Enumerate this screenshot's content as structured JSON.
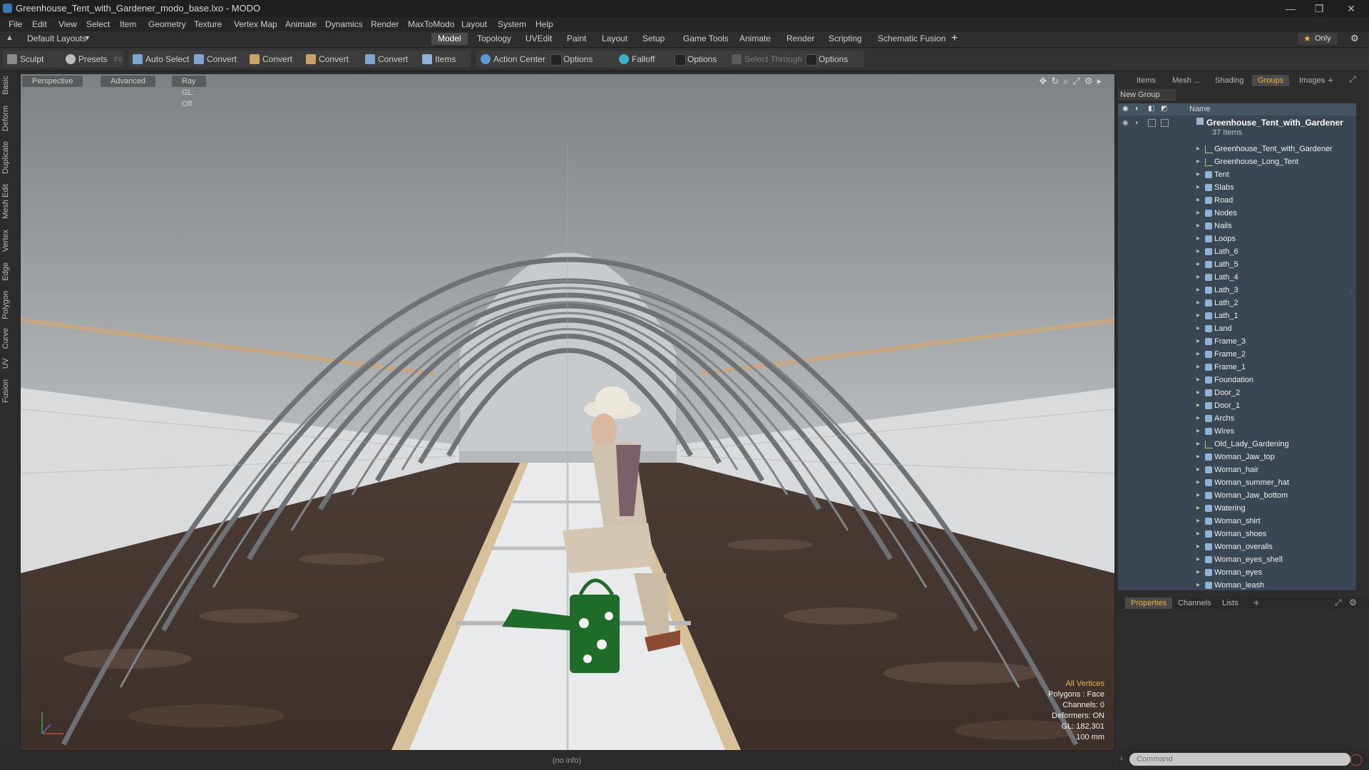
{
  "window": {
    "title": "Greenhouse_Tent_with_Gardener_modo_base.lxo - MODO",
    "controls": [
      "—",
      "❐",
      "✕"
    ]
  },
  "menu": [
    "File",
    "Edit",
    "View",
    "Select",
    "Item",
    "Geometry",
    "Texture",
    "Vertex Map",
    "Animate",
    "Dynamics",
    "Render",
    "MaxToModo",
    "Layout",
    "System",
    "Help"
  ],
  "layout_selector": "Default Layouts",
  "tabs": [
    "Model",
    "Topology",
    "UVEdit",
    "Paint",
    "Layout",
    "Setup",
    "Game Tools",
    "Animate",
    "Render",
    "Scripting",
    "Schematic Fusion"
  ],
  "active_tab": "Model",
  "only_label": "Only",
  "toolbar": {
    "sculpt": "Sculpt",
    "presets": "Presets",
    "presets_key": "F6",
    "auto_select": "Auto Select",
    "convert": "Convert",
    "items": "Items",
    "action_center": "Action Center",
    "options": "Options",
    "falloff": "Falloff",
    "select_through": "Select Through"
  },
  "left_tabs": [
    "Basic",
    "Deform",
    "Duplicate",
    "Mesh Edit",
    "Vertex",
    "Edge",
    "Polygon",
    "Curve",
    "UV",
    "Fusion"
  ],
  "viewport": {
    "view_mode": "Perspective",
    "shading": "Advanced",
    "raygl": "Ray GL: Off",
    "stats": [
      "All Vertices",
      "Polygons : Face",
      "Channels: 0",
      "Deformers: ON",
      "GL: 182,301",
      "100 mm"
    ]
  },
  "status": "(no info)",
  "right_tabs": [
    "Items",
    "Mesh ...",
    "Shading",
    "Groups",
    "Images"
  ],
  "active_right_tab": "Groups",
  "new_group": "New Group",
  "list_header": "Name",
  "group": {
    "name": "Greenhouse_Tent_with_Gardener",
    "count": "37 Items"
  },
  "items": [
    {
      "name": "Greenhouse_Tent_with_Gardener",
      "type": "locator"
    },
    {
      "name": "Greenhouse_Long_Tent",
      "type": "locator"
    },
    {
      "name": "Tent",
      "type": "mesh"
    },
    {
      "name": "Slabs",
      "type": "mesh"
    },
    {
      "name": "Road",
      "type": "mesh"
    },
    {
      "name": "Nodes",
      "type": "mesh"
    },
    {
      "name": "Nails",
      "type": "mesh"
    },
    {
      "name": "Loops",
      "type": "mesh"
    },
    {
      "name": "Lath_6",
      "type": "mesh"
    },
    {
      "name": "Lath_5",
      "type": "mesh"
    },
    {
      "name": "Lath_4",
      "type": "mesh"
    },
    {
      "name": "Lath_3",
      "type": "mesh"
    },
    {
      "name": "Lath_2",
      "type": "mesh"
    },
    {
      "name": "Lath_1",
      "type": "mesh"
    },
    {
      "name": "Land",
      "type": "mesh"
    },
    {
      "name": "Frame_3",
      "type": "mesh"
    },
    {
      "name": "Frame_2",
      "type": "mesh"
    },
    {
      "name": "Frame_1",
      "type": "mesh"
    },
    {
      "name": "Foundation",
      "type": "mesh"
    },
    {
      "name": "Door_2",
      "type": "mesh"
    },
    {
      "name": "Door_1",
      "type": "mesh"
    },
    {
      "name": "Archs",
      "type": "mesh"
    },
    {
      "name": "Wires",
      "type": "mesh"
    },
    {
      "name": "Old_Lady_Gardening",
      "type": "locator"
    },
    {
      "name": "Woman_Jaw_top",
      "type": "mesh"
    },
    {
      "name": "Woman_hair",
      "type": "mesh"
    },
    {
      "name": "Woman_summer_hat",
      "type": "mesh"
    },
    {
      "name": "Woman_Jaw_bottom",
      "type": "mesh"
    },
    {
      "name": "Watering",
      "type": "mesh"
    },
    {
      "name": "Woman_shirt",
      "type": "mesh"
    },
    {
      "name": "Woman_shoes",
      "type": "mesh"
    },
    {
      "name": "Woman_overalls",
      "type": "mesh"
    },
    {
      "name": "Woman_eyes_shell",
      "type": "mesh"
    },
    {
      "name": "Woman_eyes",
      "type": "mesh"
    },
    {
      "name": "Woman_leash",
      "type": "mesh"
    }
  ],
  "bottom_tabs": [
    "Properties",
    "Channels",
    "Lists"
  ],
  "active_bottom_tab": "Properties",
  "command_placeholder": "Command",
  "colors": {
    "accent": "#f0b43a",
    "list_bg": "#3a4652",
    "viewport_bg": "#8e9193"
  }
}
